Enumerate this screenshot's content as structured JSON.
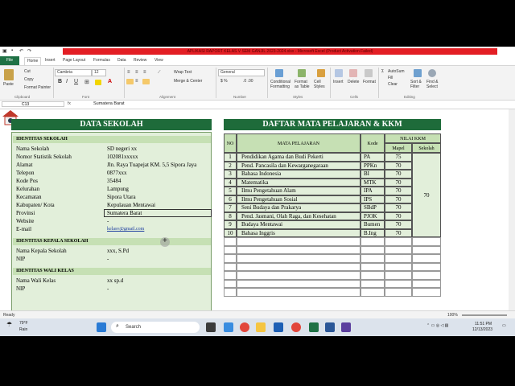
{
  "window": {
    "title": "APLIKASI RAPORT KELAS V SEM GANJIL 2023-2024.xlsx - Microsoft Excel (Product Activation Failed)"
  },
  "ribbon": {
    "tabs": [
      "File",
      "Home",
      "Insert",
      "Page Layout",
      "Formulas",
      "Data",
      "Review",
      "View"
    ],
    "paste": "Paste",
    "cut": "Cut",
    "copy": "Copy",
    "format_painter": "Format Painter",
    "font_name": "Cambria",
    "font_size": "12",
    "wrap_text": "Wrap Text",
    "merge_center": "Merge & Center",
    "number_format": "General",
    "conditional_formatting": "Conditional Formatting",
    "format_as_table": "Format as Table",
    "cell_styles": "Cell Styles",
    "insert": "Insert",
    "delete": "Delete",
    "format": "Format",
    "autosum": "AutoSum",
    "fill": "Fill",
    "clear": "Clear",
    "sort_filter": "Sort & Filter",
    "find_select": "Find & Select",
    "groups": [
      "Clipboard",
      "Font",
      "Alignment",
      "Number",
      "Styles",
      "Cells",
      "Editing"
    ]
  },
  "formula_bar": {
    "name_box": "C13",
    "fx": "fx",
    "value": "Sumatera Barat"
  },
  "data_sekolah": {
    "title": "DATA SEKOLAH",
    "section_identitas": "IDENTITAS SEKOLAH",
    "rows": [
      {
        "key": "Nama Sekolah",
        "value": "SD negeri xx"
      },
      {
        "key": "Nomor Statistik Sekolah",
        "value": "102081xxxxx"
      },
      {
        "key": "Alamat",
        "value": "Jln. Raya Tuapejat KM. 5,5 Sipora Jaya"
      },
      {
        "key": "Telepon",
        "value": "0877xxx"
      },
      {
        "key": "Kode Pos",
        "value": "35484"
      },
      {
        "key": "Kelurahan",
        "value": "Lampung"
      },
      {
        "key": "Kecamatan",
        "value": "Sipora Utara"
      },
      {
        "key": "Kabupaten/ Kota",
        "value": "Kepulauan Mentawai"
      },
      {
        "key": "Provinsi",
        "value": "Sumatera Barat"
      },
      {
        "key": "Website",
        "value": "-"
      },
      {
        "key": "E-mail",
        "value": "kelasv@gmail.com"
      }
    ],
    "section_kepala": "IDENTITAS KEPALA SEKOLAH",
    "kepala_rows": [
      {
        "key": "Nama Kepala Sekolah",
        "value": "xxx, S.Pd"
      },
      {
        "key": "NIP",
        "value": "-"
      }
    ],
    "section_wali": "IDENTITAS WALI KELAS",
    "wali_rows": [
      {
        "key": "Nama Wali Kelas",
        "value": "xx sp.d"
      },
      {
        "key": "NIP",
        "value": "-"
      }
    ]
  },
  "mapel": {
    "title": "DAFTAR MATA PELAJARAN & KKM",
    "col_no": "NO",
    "col_mapel": "MATA PELAJARAN",
    "col_kode": "Kode",
    "col_nilai": "NILAI KKM",
    "col_nilai_mapel": "Mapel",
    "col_nilai_sekolah": "Sekolah",
    "sekolah_value": "70",
    "rows": [
      {
        "no": "1",
        "name": "Pendidikan Agama dan Budi Pekerti",
        "kode": "PA",
        "kkm": "75"
      },
      {
        "no": "2",
        "name": "Pend. Pancasila dan Kewarganegaraan",
        "kode": "PPKn",
        "kkm": "70"
      },
      {
        "no": "3",
        "name": "Bahasa Indonesia",
        "kode": "BI",
        "kkm": "70"
      },
      {
        "no": "4",
        "name": "Matematika",
        "kode": "MTK",
        "kkm": "70"
      },
      {
        "no": "5",
        "name": "Ilmu Pengetahuan Alam",
        "kode": "IPA",
        "kkm": "70"
      },
      {
        "no": "6",
        "name": "Ilmu Pengetahuan Sosial",
        "kode": "IPS",
        "kkm": "70"
      },
      {
        "no": "7",
        "name": "Seni Budaya dan Prakarya",
        "kode": "SBdP",
        "kkm": "70"
      },
      {
        "no": "8",
        "name": "Pend. Jasmani, Olah Raga, dan Kesehatan",
        "kode": "PJOK",
        "kkm": "70"
      },
      {
        "no": "9",
        "name": "Budaya Mentawai",
        "kode": "Bumen",
        "kkm": "70"
      },
      {
        "no": "10",
        "name": "Bahasa Inggris",
        "kode": "B.Ing",
        "kkm": "70"
      }
    ]
  },
  "status": {
    "ready": "Ready",
    "zoom": "100%"
  },
  "taskbar": {
    "weather_temp": "79°F",
    "weather_desc": "Rain",
    "search": "Search",
    "time": "11:51 PM",
    "date": "12/13/2023"
  },
  "colors": {
    "header_green": "#1e6b3a",
    "section_green": "#c6e0b4",
    "body_green": "#e2efda",
    "excel_green": "#1f7145",
    "title_red": "#e31e24"
  }
}
